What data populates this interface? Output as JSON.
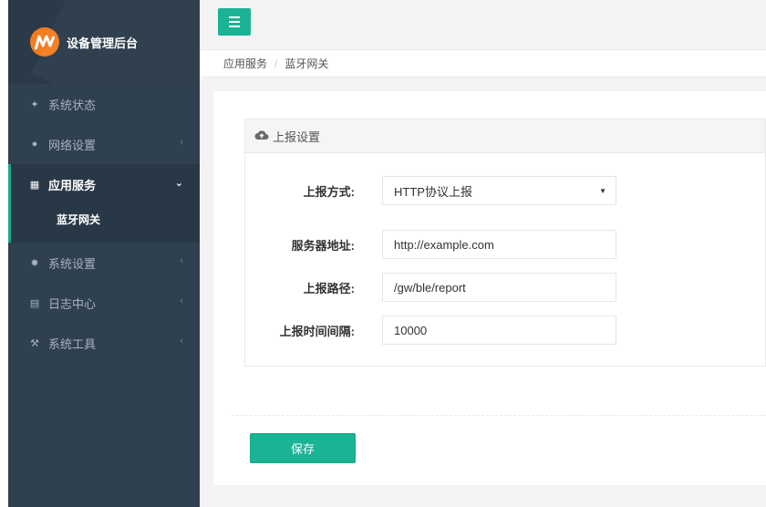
{
  "app": {
    "brand": "设备管理后台"
  },
  "sidebar": {
    "items": [
      {
        "icon": "home-icon",
        "glyph": "✦",
        "label": "系统状态",
        "arrow": ""
      },
      {
        "icon": "globe-icon",
        "glyph": "●",
        "label": "网络设置",
        "arrow": "‹"
      },
      {
        "icon": "grid-icon",
        "glyph": "▦",
        "label": "应用服务",
        "arrow": "⌄",
        "active": true,
        "children": [
          {
            "label": "蓝牙网关"
          }
        ]
      },
      {
        "icon": "gear-icon",
        "glyph": "✹",
        "label": "系统设置",
        "arrow": "‹"
      },
      {
        "icon": "file-icon",
        "glyph": "▤",
        "label": "日志中心",
        "arrow": "‹"
      },
      {
        "icon": "wrench-icon",
        "glyph": "⚒",
        "label": "系统工具",
        "arrow": "‹"
      }
    ]
  },
  "breadcrumb": {
    "parent": "应用服务",
    "separator": "/",
    "current": "蓝牙网关"
  },
  "panel": {
    "title": "上报设置"
  },
  "form": {
    "report_method_label": "上报方式:",
    "report_method_value": "HTTP协议上报",
    "server_label": "服务器地址:",
    "server_value": "http://example.com",
    "path_label": "上报路径:",
    "path_value": "/gw/ble/report",
    "interval_label": "上报时间间隔:",
    "interval_value": "10000"
  },
  "actions": {
    "save_label": "保存"
  },
  "colors": {
    "accent": "#1ab394",
    "sidebar": "#2f4050",
    "logo": "#f47c20"
  }
}
